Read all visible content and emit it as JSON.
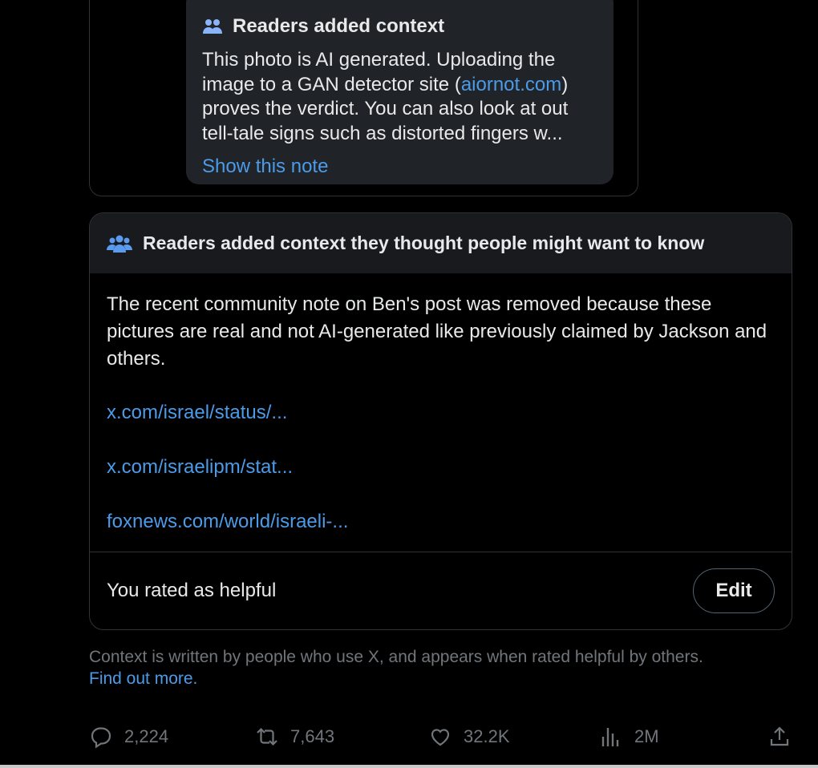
{
  "quoted_note": {
    "heading": "Readers added context",
    "text_before_link": "This photo is AI generated. Uploading the image to a GAN detector site (",
    "link": "aiornot.com",
    "text_after_link": ") proves the verdict. You can also look at out tell-tale signs such as distorted fingers w...",
    "show_label": "Show this note",
    "icon": "people-icon"
  },
  "community_note": {
    "heading": "Readers added context they thought people might want to know",
    "icon": "people-icon",
    "text": "The recent community note on Ben's post was removed because these pictures are real and not AI-generated like previously claimed by Jackson and others.",
    "links": [
      "x.com/israel/status/...",
      "x.com/israelipm/stat...",
      "foxnews.com/world/israeli-..."
    ],
    "rating": "You rated as helpful",
    "edit_label": "Edit"
  },
  "disclaimer": {
    "text": "Context is written by people who use X, and appears when rated helpful by others.",
    "find_out": "Find out more."
  },
  "actions": {
    "replies": "2,224",
    "reposts": "7,643",
    "likes": "32.2K",
    "views": "2M"
  },
  "colors": {
    "background": "#000000",
    "link": "#4c9be8",
    "muted": "#71767b",
    "border": "#2f3336"
  }
}
